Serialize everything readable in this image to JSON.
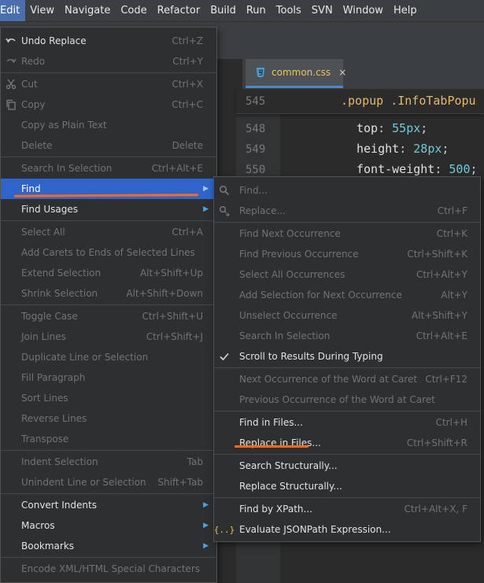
{
  "menubar": [
    "Edit",
    "View",
    "Navigate",
    "Code",
    "Refactor",
    "Build",
    "Run",
    "Tools",
    "SVN",
    "Window",
    "Help"
  ],
  "tab": {
    "file_name": "common.css",
    "close": "×",
    "icon": "css-file-icon"
  },
  "editor": {
    "sticky": {
      "line": "545",
      "text": ".popup .InfoTabPopu"
    },
    "lines": [
      {
        "n": "548",
        "prop": "top",
        "num": "55",
        "unit": "px"
      },
      {
        "n": "549",
        "prop": "height",
        "num": "28",
        "unit": "px"
      },
      {
        "n": "550",
        "prop": "font-weight",
        "num": "500",
        "unit": ""
      }
    ]
  },
  "edit_menu": [
    {
      "label": "Undo Replace",
      "shortcut": "Ctrl+Z",
      "enabled": true,
      "icon": "undo-icon"
    },
    {
      "label": "Redo",
      "shortcut": "Ctrl+Y",
      "enabled": false,
      "icon": "redo-icon"
    },
    {
      "label": "Cut",
      "shortcut": "Ctrl+X",
      "enabled": false,
      "icon": "scissors-icon"
    },
    {
      "label": "Copy",
      "shortcut": "Ctrl+C",
      "enabled": false,
      "icon": "copy-icon"
    },
    {
      "label": "Copy as Plain Text",
      "shortcut": "",
      "enabled": false
    },
    {
      "label": "Delete",
      "shortcut": "Delete",
      "enabled": false
    },
    {
      "label": "Search In Selection",
      "shortcut": "Ctrl+Alt+E",
      "enabled": false
    },
    {
      "label": "Find",
      "shortcut": "",
      "enabled": true,
      "submenu": true,
      "active": true
    },
    {
      "label": "Find Usages",
      "shortcut": "",
      "enabled": true,
      "submenu": true
    },
    {
      "label": "Select All",
      "shortcut": "Ctrl+A",
      "enabled": false
    },
    {
      "label": "Add Carets to Ends of Selected Lines",
      "shortcut": "",
      "enabled": false
    },
    {
      "label": "Extend Selection",
      "shortcut": "Alt+Shift+Up",
      "enabled": false
    },
    {
      "label": "Shrink Selection",
      "shortcut": "Alt+Shift+Down",
      "enabled": false
    },
    {
      "label": "Toggle Case",
      "shortcut": "Ctrl+Shift+U",
      "enabled": false
    },
    {
      "label": "Join Lines",
      "shortcut": "Ctrl+Shift+J",
      "enabled": false
    },
    {
      "label": "Duplicate Line or Selection",
      "shortcut": "",
      "enabled": false
    },
    {
      "label": "Fill Paragraph",
      "shortcut": "",
      "enabled": false
    },
    {
      "label": "Sort Lines",
      "shortcut": "",
      "enabled": false
    },
    {
      "label": "Reverse Lines",
      "shortcut": "",
      "enabled": false
    },
    {
      "label": "Transpose",
      "shortcut": "",
      "enabled": false
    },
    {
      "label": "Indent Selection",
      "shortcut": "Tab",
      "enabled": false
    },
    {
      "label": "Unindent Line or Selection",
      "shortcut": "Shift+Tab",
      "enabled": false
    },
    {
      "label": "Convert Indents",
      "shortcut": "",
      "enabled": true,
      "submenu": true
    },
    {
      "label": "Macros",
      "shortcut": "",
      "enabled": true,
      "submenu": true
    },
    {
      "label": "Bookmarks",
      "shortcut": "",
      "enabled": true,
      "submenu": true
    },
    {
      "label": "Encode XML/HTML Special Characters",
      "shortcut": "",
      "enabled": false
    }
  ],
  "find_menu": [
    {
      "label": "Find...",
      "shortcut": "",
      "enabled": false,
      "icon": "search-icon"
    },
    {
      "label": "Replace...",
      "shortcut": "Ctrl+F",
      "enabled": false,
      "icon": "replace-icon"
    },
    {
      "label": "Find Next Occurrence",
      "shortcut": "Ctrl+K",
      "enabled": false
    },
    {
      "label": "Find Previous Occurrence",
      "shortcut": "Ctrl+Shift+K",
      "enabled": false
    },
    {
      "label": "Select All Occurrences",
      "shortcut": "Ctrl+Alt+Y",
      "enabled": false
    },
    {
      "label": "Add Selection for Next Occurrence",
      "shortcut": "Alt+Y",
      "enabled": false
    },
    {
      "label": "Unselect Occurrence",
      "shortcut": "Alt+Shift+Y",
      "enabled": false
    },
    {
      "label": "Search In Selection",
      "shortcut": "Ctrl+Alt+E",
      "enabled": false
    },
    {
      "label": "Scroll to Results During Typing",
      "shortcut": "",
      "enabled": true,
      "icon": "checkmark-icon"
    },
    {
      "label": "Next Occurrence of the Word at Caret",
      "shortcut": "Ctrl+F12",
      "enabled": false
    },
    {
      "label": "Previous Occurrence of the Word at Caret",
      "shortcut": "",
      "enabled": false
    },
    {
      "label": "Find in Files...",
      "shortcut": "Ctrl+H",
      "enabled": true
    },
    {
      "label": "Replace in Files...",
      "shortcut": "Ctrl+Shift+R",
      "enabled": true
    },
    {
      "label": "Search Structurally...",
      "shortcut": "",
      "enabled": true
    },
    {
      "label": "Replace Structurally...",
      "shortcut": "",
      "enabled": true
    },
    {
      "label": "Find by XPath...",
      "shortcut": "Ctrl+Alt+X, F",
      "enabled": true
    },
    {
      "label": "Evaluate JSONPath Expression...",
      "shortcut": "",
      "enabled": true,
      "icon": "json-braces-icon"
    }
  ],
  "colors": {
    "accent": "#2f65ca",
    "annotation": "#ff6a1a",
    "menu_bg": "#2d2f31",
    "disabled_text": "#737373"
  }
}
